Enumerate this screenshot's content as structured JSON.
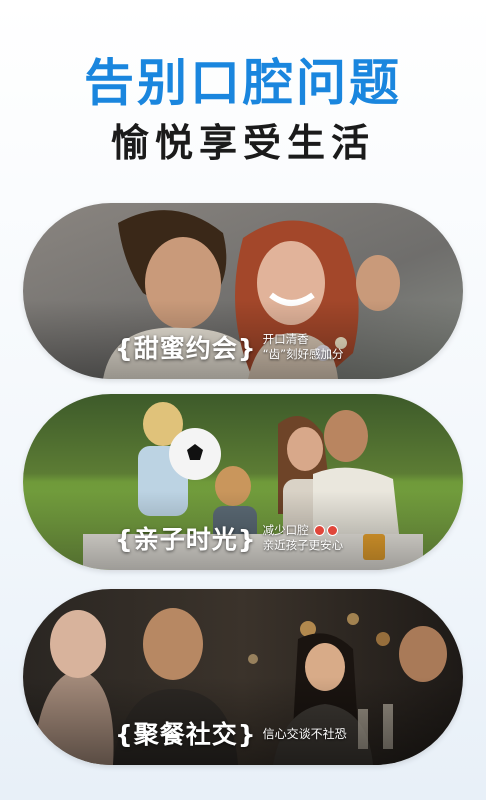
{
  "headline": "告别口腔问题",
  "subline": "愉悦享受生活",
  "cards": [
    {
      "tag": "{甜蜜约会}",
      "lines": [
        "开口清香",
        "“齿”刻好感加分"
      ]
    },
    {
      "tag": "{亲子时光}",
      "lines": [
        "减少口腔",
        "亲近孩子更安心"
      ],
      "icons": [
        "no-smoking-icon",
        "no-sugar-icon"
      ]
    },
    {
      "tag": "{聚餐社交}",
      "lines": [
        "信心交谈不社恐"
      ]
    }
  ],
  "colors": {
    "headline": "#1a86de",
    "subline": "#1b1b1b"
  }
}
